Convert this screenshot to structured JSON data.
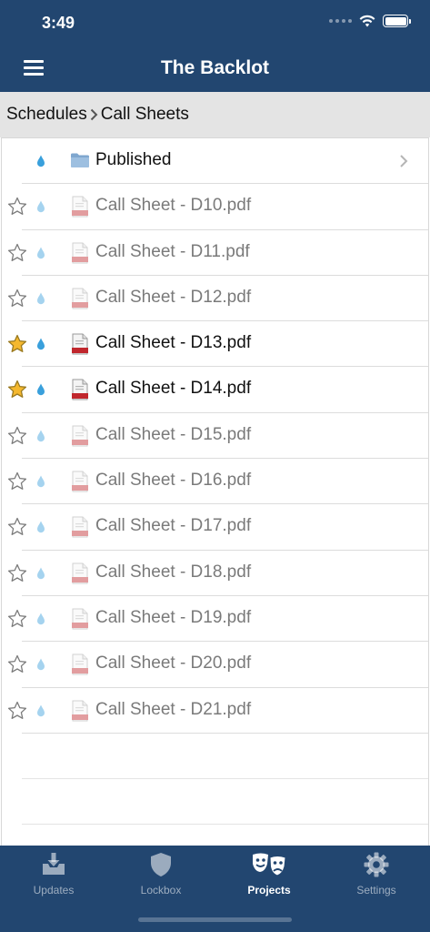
{
  "status": {
    "time": "3:49"
  },
  "nav": {
    "title": "The Backlot"
  },
  "breadcrumb": {
    "parent": "Schedules",
    "separator": ">",
    "current": "Call Sheets"
  },
  "folder": {
    "label": "Published"
  },
  "files": [
    {
      "name": "Call Sheet - D10.pdf",
      "starred": false,
      "downloaded": false
    },
    {
      "name": "Call Sheet - D11.pdf",
      "starred": false,
      "downloaded": false
    },
    {
      "name": "Call Sheet - D12.pdf",
      "starred": false,
      "downloaded": false
    },
    {
      "name": "Call Sheet - D13.pdf",
      "starred": true,
      "downloaded": true
    },
    {
      "name": "Call Sheet - D14.pdf",
      "starred": true,
      "downloaded": true
    },
    {
      "name": "Call Sheet - D15.pdf",
      "starred": false,
      "downloaded": false
    },
    {
      "name": "Call Sheet - D16.pdf",
      "starred": false,
      "downloaded": false
    },
    {
      "name": "Call Sheet - D17.pdf",
      "starred": false,
      "downloaded": false
    },
    {
      "name": "Call Sheet - D18.pdf",
      "starred": false,
      "downloaded": false
    },
    {
      "name": "Call Sheet - D19.pdf",
      "starred": false,
      "downloaded": false
    },
    {
      "name": "Call Sheet - D20.pdf",
      "starred": false,
      "downloaded": false
    },
    {
      "name": "Call Sheet - D21.pdf",
      "starred": false,
      "downloaded": false
    }
  ],
  "tabs": [
    {
      "label": "Updates",
      "icon": "updates-icon"
    },
    {
      "label": "Lockbox",
      "icon": "shield-icon"
    },
    {
      "label": "Projects",
      "icon": "theater-masks-icon",
      "selected": true
    },
    {
      "label": "Settings",
      "icon": "gear-icon"
    }
  ],
  "colors": {
    "header": "#224670",
    "star_active": "#f5b82e",
    "drop": "#3aa0dc",
    "pdf_red": "#c0272d"
  }
}
